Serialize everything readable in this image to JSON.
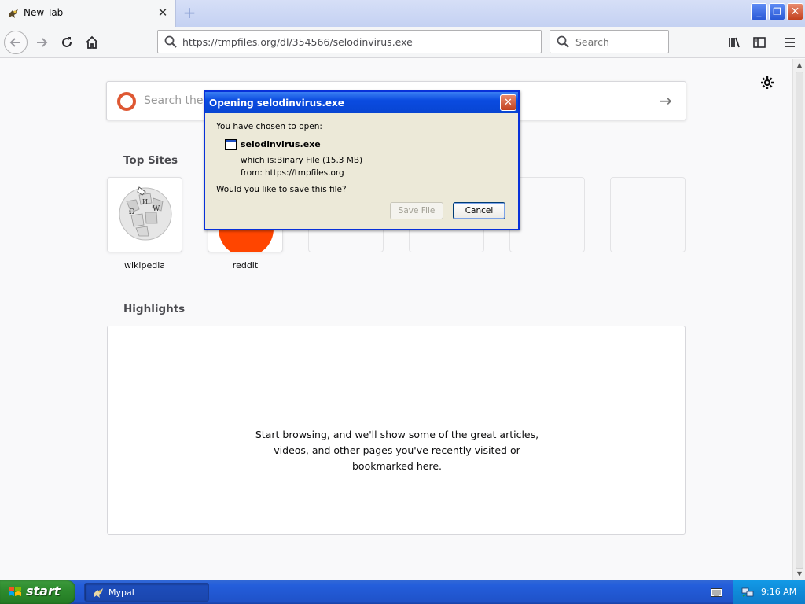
{
  "tab": {
    "title": "New Tab",
    "close": "✕"
  },
  "newtab": "+",
  "window": {
    "minimize": "_",
    "restore": "❐",
    "close": "✕"
  },
  "urlbar": {
    "url": "https://tmpfiles.org/dl/354566/selodinvirus.exe"
  },
  "searchbar": {
    "placeholder": "Search"
  },
  "newtab_page": {
    "websearch_placeholder": "Search the W",
    "top_sites_title": "Top Sites",
    "top_sites": [
      {
        "label": "wikipedia"
      },
      {
        "label": "reddit"
      }
    ],
    "highlights_title": "Highlights",
    "highlights_message": "Start browsing, and we'll show some of the great articles, videos, and other pages you've recently visited or bookmarked here."
  },
  "dialog": {
    "title": "Opening selodinvirus.exe",
    "close": "✕",
    "intro": "You have chosen to open:",
    "filename": "selodinvirus.exe",
    "which_is_label": "which is:",
    "which_is": "Binary File (15.3 MB)",
    "from_label": "from:",
    "from": "https://tmpfiles.org",
    "question": "Would you like to save this file?",
    "save_button": "Save File",
    "cancel_button": "Cancel",
    "save_enabled": false
  },
  "taskbar": {
    "start_label": "start",
    "items": [
      {
        "label": "Mypal"
      }
    ],
    "clock": "9:16 AM"
  },
  "colors": {
    "xp_blue": "#245edb",
    "start_green": "#2e8b2e",
    "reddit": "#ff4500",
    "duckduckgo": "#de5833"
  }
}
